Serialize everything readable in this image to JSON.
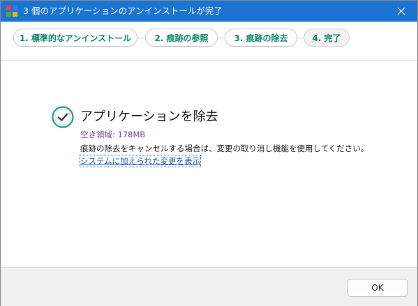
{
  "window": {
    "title": "3 個のアプリケーションのアンインストールが完了",
    "accent_color": "#1b73d2",
    "icons": [
      "app-icon",
      "close-icon"
    ]
  },
  "steps": [
    {
      "label": "1. 標準的なアンインストール",
      "state": "done"
    },
    {
      "label": "2. 痕跡の参照",
      "state": "done"
    },
    {
      "label": "3. 痕跡の除去",
      "state": "done"
    },
    {
      "label": "4. 完了",
      "state": "current"
    }
  ],
  "result": {
    "heading": "アプリケーションを除去",
    "space_text": "空き領域: 178MB",
    "description": "痕跡の除去をキャンセルする場合は、変更の取り消し機能を使用してください。",
    "link_text": "システムに加えられた変更を表示",
    "status_icon": "check-circle-icon",
    "status_color": "#19a187"
  },
  "footer": {
    "ok_label": "OK"
  }
}
